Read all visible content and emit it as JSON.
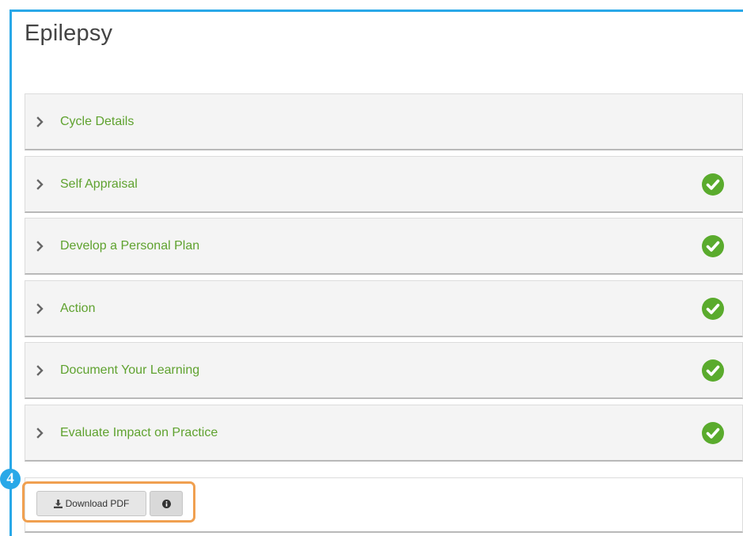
{
  "page": {
    "title": "Epilepsy"
  },
  "sections": [
    {
      "label": "Cycle Details",
      "completed": false
    },
    {
      "label": "Self Appraisal",
      "completed": true
    },
    {
      "label": "Develop a Personal Plan",
      "completed": true
    },
    {
      "label": "Action",
      "completed": true
    },
    {
      "label": "Document Your Learning",
      "completed": true
    },
    {
      "label": "Evaluate Impact on Practice",
      "completed": true
    }
  ],
  "footer": {
    "download_label": "Download PDF",
    "step_number": "4"
  },
  "colors": {
    "accent_border": "#29a8e8",
    "section_label": "#5fa22f",
    "check_green": "#5aab2d",
    "highlight": "#f0a050"
  },
  "icons": {
    "expand": "chevron-right-icon",
    "completed": "check-circle-icon",
    "download": "download-icon",
    "info": "info-circle-icon"
  }
}
